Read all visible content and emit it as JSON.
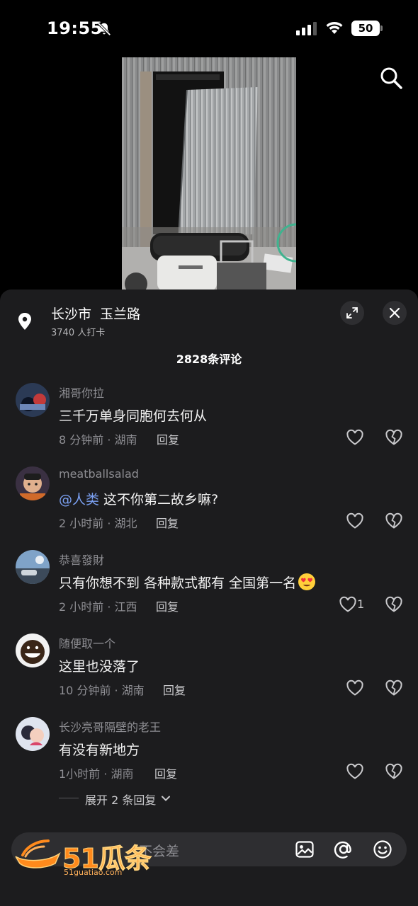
{
  "status_bar": {
    "time": "19:55",
    "battery": "50"
  },
  "location": {
    "title": "长沙市  玉兰路",
    "checkins": "3740 人打卡"
  },
  "comments_header": {
    "count_label": "2828条评论"
  },
  "comments": [
    {
      "user": "湘哥你拉",
      "text": "三千万单身同胞何去何从",
      "meta": "8 分钟前 · 湖南",
      "reply": "回复",
      "likes": ""
    },
    {
      "user": "meatballsalad",
      "mention": "@人类",
      "text": " 这不你第二故乡嘛?",
      "meta": "2 小时前 · 湖北",
      "reply": "回复",
      "likes": ""
    },
    {
      "user": "恭喜發財",
      "text": "只有你想不到 各种款式都有 全国第一名",
      "meta": "2 小时前 · 江西",
      "reply": "回复",
      "likes": "1",
      "emoji": "heart-eyes-emoji"
    },
    {
      "user": "随便取一个",
      "text": "这里也没落了",
      "meta": "10 分钟前 · 湖南",
      "reply": "回复",
      "likes": ""
    },
    {
      "user": "长沙亮哥隔壁的老王",
      "text": "有没有新地方",
      "meta": "1小时前 · 湖南",
      "reply": "回复",
      "likes": ""
    }
  ],
  "expand_replies": {
    "label": "展开 2 条回复"
  },
  "input": {
    "placeholder": "不会差"
  },
  "watermark": {
    "brand": "51瓜条",
    "url": "51guatiao.com"
  },
  "icons": [
    "bell-slash-icon",
    "signal-icon",
    "wifi-icon",
    "search-icon",
    "location-pin-icon",
    "expand-icon",
    "close-icon",
    "heart-icon",
    "broken-heart-icon",
    "chevron-down-icon",
    "image-icon",
    "at-icon",
    "emoji-icon"
  ],
  "colors": {
    "sheet_bg": "#1c1c1e",
    "mention": "#7a9ff0",
    "secondary_text": "#8e8e93",
    "watermark": "#ff8a1c"
  }
}
